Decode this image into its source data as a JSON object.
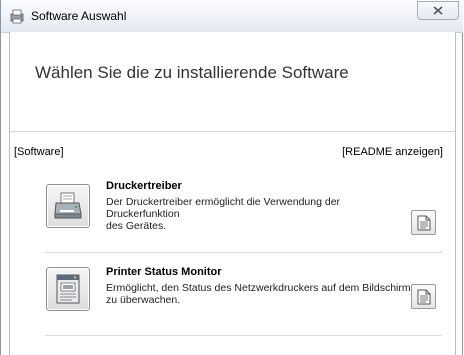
{
  "window": {
    "title": "Software Auswahl",
    "close_label": "x"
  },
  "main": {
    "heading": "Wählen Sie die zu installierende Software",
    "software_label": "[Software]",
    "readme_label": "[README anzeigen]"
  },
  "items": [
    {
      "title": "Druckertreiber",
      "desc_line1": "Der Druckertreiber ermöglicht die Verwendung der Druckerfunktion",
      "desc_line2": "des Gerätes.",
      "icon": "printer-icon"
    },
    {
      "title": "Printer Status Monitor",
      "desc_line1": "Ermöglicht, den Status des Netzwerkdruckers auf dem Bildschirm",
      "desc_line2": "zu überwachen.",
      "icon": "status-monitor-icon"
    }
  ]
}
